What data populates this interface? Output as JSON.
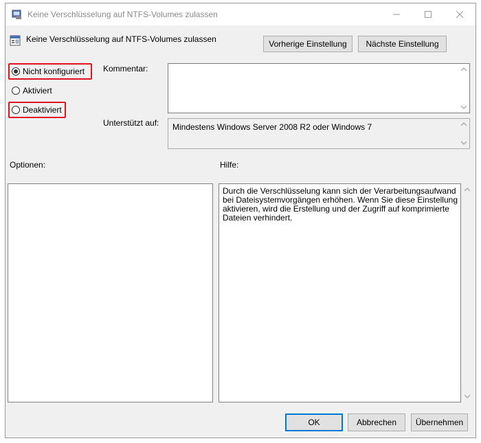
{
  "window": {
    "title": "Keine Verschlüsselung auf NTFS-Volumes zulassen"
  },
  "header": {
    "policy_name": "Keine Verschlüsselung auf NTFS-Volumes zulassen",
    "prev_label": "Vorherige Einstellung",
    "next_label": "Nächste Einstellung"
  },
  "state": {
    "options": [
      {
        "label": "Nicht konfiguriert",
        "selected": true
      },
      {
        "label": "Aktiviert",
        "selected": false
      },
      {
        "label": "Deaktiviert",
        "selected": false
      }
    ]
  },
  "comment": {
    "label": "Kommentar:",
    "value": ""
  },
  "supported": {
    "label": "Unterstützt auf:",
    "value": "Mindestens Windows Server 2008 R2 oder Windows 7"
  },
  "options_panel": {
    "label": "Optionen:"
  },
  "help_panel": {
    "label": "Hilfe:",
    "text": "Durch die Verschlüsselung kann sich der Verarbeitungsaufwand bei Dateisystemvorgängen erhöhen.  Wenn Sie diese Einstellung aktivieren, wird die Erstellung und der Zugriff auf komprimierte Dateien verhindert."
  },
  "footer": {
    "ok_label": "OK",
    "cancel_label": "Abbrechen",
    "apply_label": "Übernehmen"
  },
  "colors": {
    "highlight": "#e0141e",
    "window_bg": "#f0f0f0",
    "accent": "#0078d7"
  }
}
